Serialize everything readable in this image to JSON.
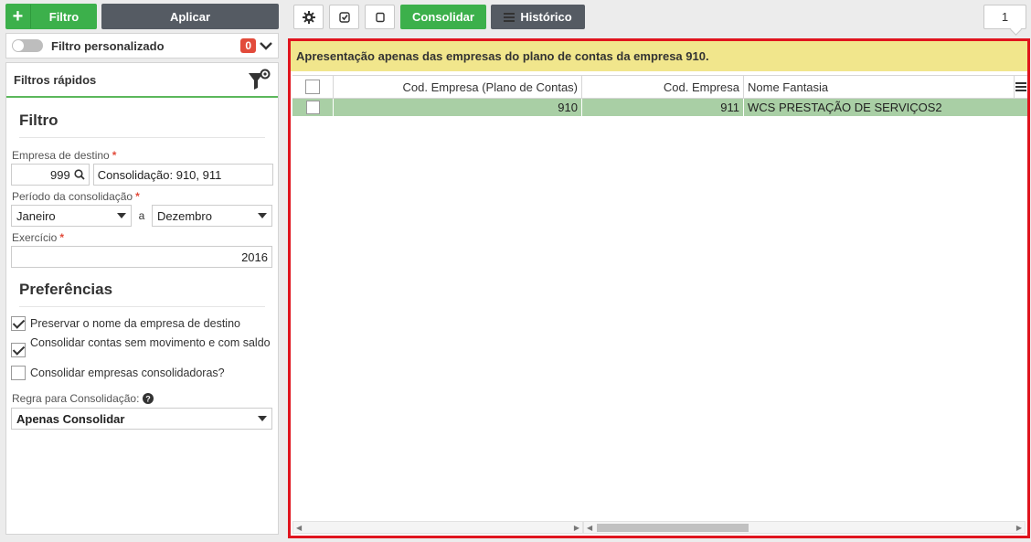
{
  "sidebar": {
    "filter_button": "Filtro",
    "apply_button": "Aplicar",
    "custom_filter_label": "Filtro personalizado",
    "custom_filter_count": "0",
    "quick_filters_title": "Filtros rápidos",
    "filter_section_title": "Filtro",
    "target_company_label": "Empresa de destino",
    "target_company_code": "999",
    "target_company_name": "Consolidação: 910, 911",
    "period_label": "Período da consolidação",
    "period_from": "Janeiro",
    "period_separator": "a",
    "period_to": "Dezembro",
    "exercise_label": "Exercício",
    "exercise_value": "2016",
    "preferences_title": "Preferências",
    "pref_preserve_name": "Preservar o nome da empresa de destino",
    "pref_preserve_checked": true,
    "pref_consolidate_accounts": "Consolidar contas sem movimento e com saldo",
    "pref_consolidate_accounts_checked": true,
    "pref_consolidate_companies": "Consolidar empresas consolidadoras?",
    "pref_consolidate_companies_checked": false,
    "rule_label": "Regra para Consolidação:",
    "rule_value": "Apenas Consolidar",
    "required_mark": "*"
  },
  "toolbar": {
    "consolidate_button": "Consolidar",
    "history_button": "Histórico",
    "page_number": "1"
  },
  "grid": {
    "notice": "Apresentação apenas das empresas do plano de contas da empresa 910.",
    "columns": [
      "Cod. Empresa (Plano de Contas)",
      "Cod. Empresa",
      "Nome Fantasia"
    ],
    "rows": [
      {
        "plan_code": "910",
        "company_code": "911",
        "name": "WCS PRESTAÇÃO DE SERVIÇOS2"
      }
    ]
  },
  "colors": {
    "accent_green": "#3cb04b",
    "dark_button": "#555b63",
    "highlight_border": "#e0141e",
    "notice_bg": "#f1e68c",
    "selected_row": "#a9cfa5"
  },
  "icons": [
    "plus-icon",
    "filter-gear-icon",
    "search-icon",
    "help-icon",
    "gear-icon",
    "check-square-icon",
    "square-icon",
    "list-icon",
    "chevron-down-icon"
  ]
}
